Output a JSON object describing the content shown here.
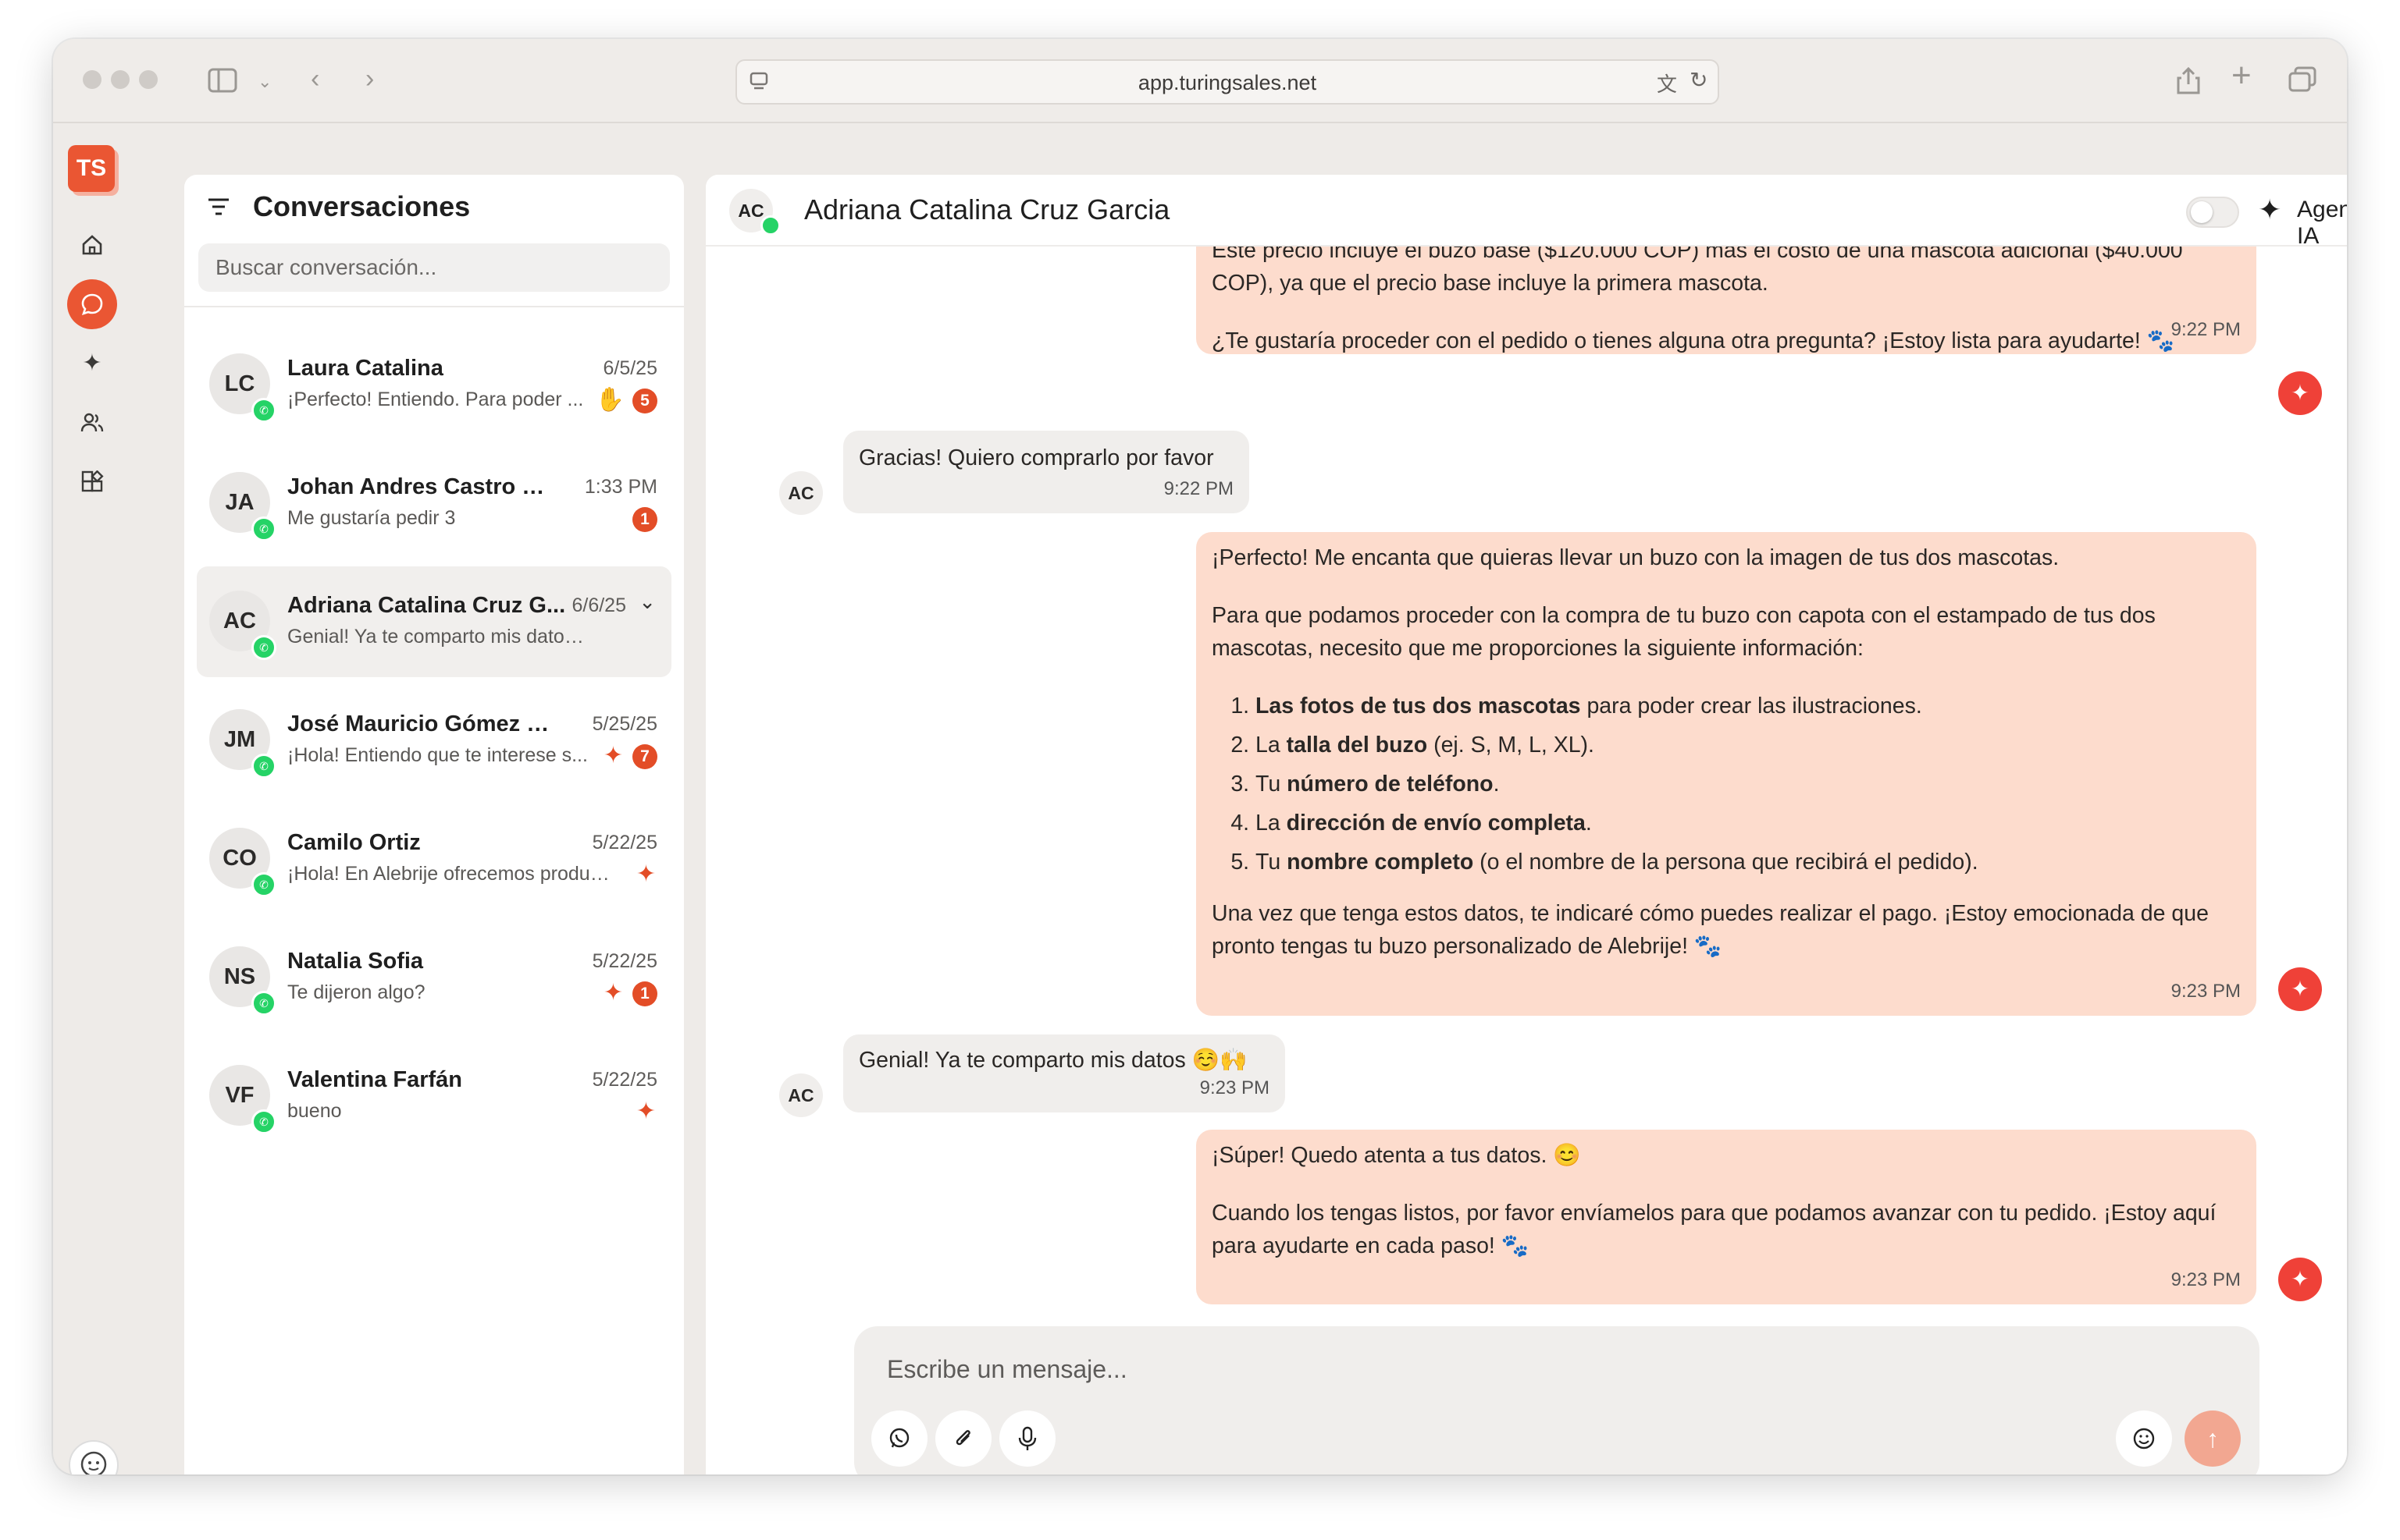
{
  "browser": {
    "url": "app.turingsales.net"
  },
  "nav": {
    "logo": "TS",
    "icons": [
      "home-icon",
      "chat-icon",
      "sparkle-icon",
      "users-icon",
      "apps-icon"
    ]
  },
  "conversations": {
    "title": "Conversaciones",
    "search_placeholder": "Buscar conversación...",
    "items": [
      {
        "initials": "LC",
        "name": "Laura Catalina",
        "date": "6/5/25",
        "preview": "¡Perfecto! Entiendo. Para poder ...",
        "badge": "5",
        "icon": "hand"
      },
      {
        "initials": "JA",
        "name": "Johan Andres Castro Go...",
        "date": "1:33 PM",
        "preview": "Me gustaría pedir 3",
        "badge": "1",
        "icon": ""
      },
      {
        "initials": "AC",
        "name": "Adriana Catalina Cruz G...",
        "date": "6/6/25",
        "preview": "Genial! Ya te comparto mis datos ☺️🙌",
        "badge": "",
        "icon": ""
      },
      {
        "initials": "JM",
        "name": "José Mauricio Gómez Co...",
        "date": "5/25/25",
        "preview": "¡Hola! Entiendo que te interese s...",
        "badge": "7",
        "icon": "sparkle"
      },
      {
        "initials": "CO",
        "name": "Camilo Ortiz",
        "date": "5/22/25",
        "preview": "¡Hola! En Alebrije ofrecemos produc...",
        "badge": "",
        "icon": "sparkle"
      },
      {
        "initials": "NS",
        "name": "Natalia Sofia",
        "date": "5/22/25",
        "preview": "Te dijeron algo?",
        "badge": "1",
        "icon": "sparkle"
      },
      {
        "initials": "VF",
        "name": "Valentina Farfán",
        "date": "5/22/25",
        "preview": "bueno",
        "badge": "",
        "icon": "sparkle"
      }
    ]
  },
  "chat": {
    "contact_initials": "AC",
    "contact_name": "Adriana Catalina Cruz Garcia",
    "agent_label": "Agente IA",
    "messages": {
      "m1": {
        "p1": "Este precio incluye el buzo base ($120.000 COP) más el costo de una mascota adicional ($40.000 COP), ya que el precio base incluye la primera mascota.",
        "p2": "¿Te gustaría proceder con el pedido o tienes alguna otra pregunta? ¡Estoy lista para ayudarte! 🐾",
        "time": "9:22 PM"
      },
      "m2": {
        "text": "Gracias! Quiero comprarlo por favor",
        "time": "9:22 PM"
      },
      "m3": {
        "p1": "¡Perfecto! Me encanta que quieras llevar un buzo con la imagen de tus dos mascotas.",
        "p2": "Para que podamos proceder con la compra de tu buzo con capota con el estampado de tus dos mascotas, necesito que me proporciones la siguiente información:",
        "steps": [
          {
            "pre": "",
            "bold": "Las fotos de tus dos mascotas",
            "post": " para poder crear las ilustraciones."
          },
          {
            "pre": "La ",
            "bold": "talla del buzo",
            "post": " (ej. S, M, L, XL)."
          },
          {
            "pre": "Tu ",
            "bold": "número de teléfono",
            "post": "."
          },
          {
            "pre": "La ",
            "bold": "dirección de envío completa",
            "post": "."
          },
          {
            "pre": "Tu ",
            "bold": "nombre completo",
            "post": " (o el nombre de la persona que recibirá el pedido)."
          }
        ],
        "p3": "Una vez que tenga estos datos, te indicaré cómo puedes realizar el pago. ¡Estoy emocionada de que pronto tengas tu buzo personalizado de Alebrije! 🐾",
        "time": "9:23 PM"
      },
      "m4": {
        "text": "Genial! Ya te comparto mis datos ☺️🙌",
        "time": "9:23 PM"
      },
      "m5": {
        "p1": "¡Súper! Quedo atenta a tus datos. 😊",
        "p2": "Cuando los tengas listos, por favor envíamelos para que podamos avanzar con tu pedido. ¡Estoy aquí para ayudarte en cada paso! 🐾",
        "time": "9:23 PM"
      }
    },
    "composer_placeholder": "Escribe un mensaje..."
  }
}
